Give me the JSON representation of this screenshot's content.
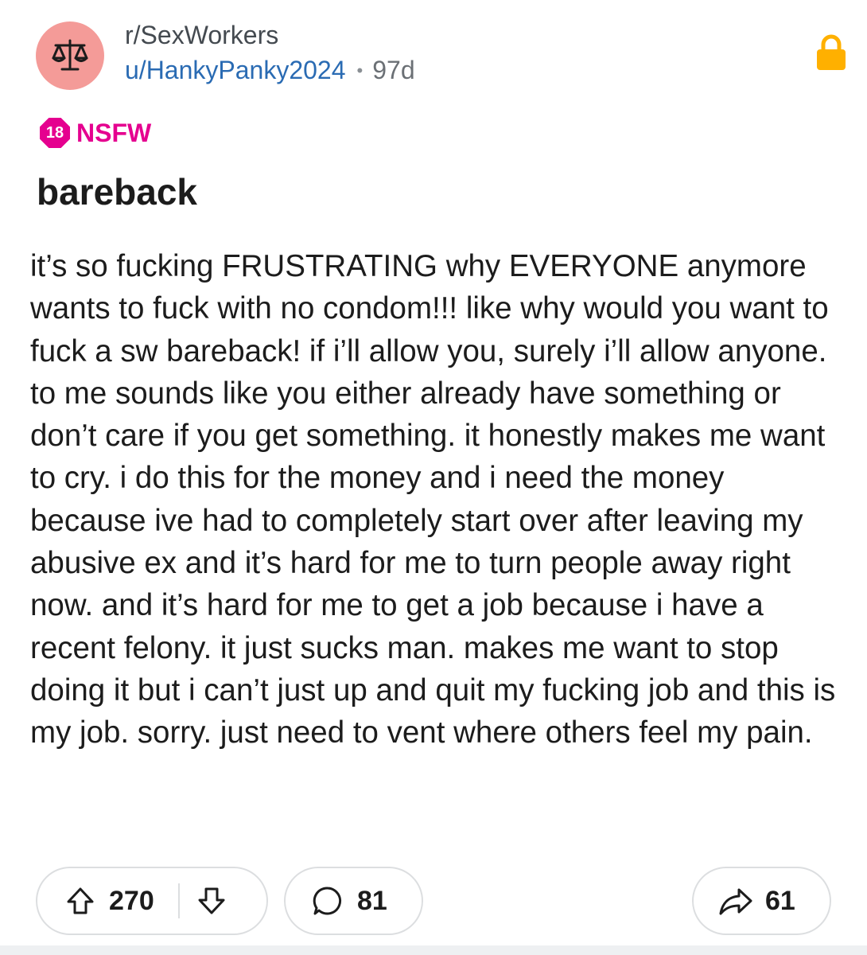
{
  "post": {
    "subreddit": "r/SexWorkers",
    "author": "u/HankyPanky2024",
    "separator": "•",
    "age": "97d",
    "nsfw_badge": "18",
    "nsfw_label": "NSFW",
    "title": "bareback",
    "body": "it’s so fucking FRUSTRATING why EVERYONE anymore wants to fuck with no condom!!! like why would you want to fuck a sw bareback! if i’ll allow you, surely i’ll allow anyone. to me sounds like you either already have something or don’t care if you get something. it honestly makes me want to cry. i do this for the money and i need the money because ive had to completely start over after leaving my abusive ex and it’s hard for me to turn people away right now. and it’s hard for me to get a job because i have a recent felony. it just sucks man. makes me want to stop doing it but i can’t just up and quit my fucking job and this is my job. sorry. just need to vent where others feel my pain."
  },
  "actions": {
    "upvotes": "270",
    "comments": "81",
    "shares": "61"
  },
  "icons": {
    "avatar": "scales-icon",
    "lock": "lock-icon",
    "upvote": "upvote-arrow-icon",
    "downvote": "downvote-arrow-icon",
    "comment": "comment-bubble-icon",
    "share": "share-arrow-icon"
  },
  "colors": {
    "avatar_bg": "#f49b98",
    "nsfw": "#e5008f",
    "lock": "#ffb000",
    "username": "#2a6bb3"
  }
}
